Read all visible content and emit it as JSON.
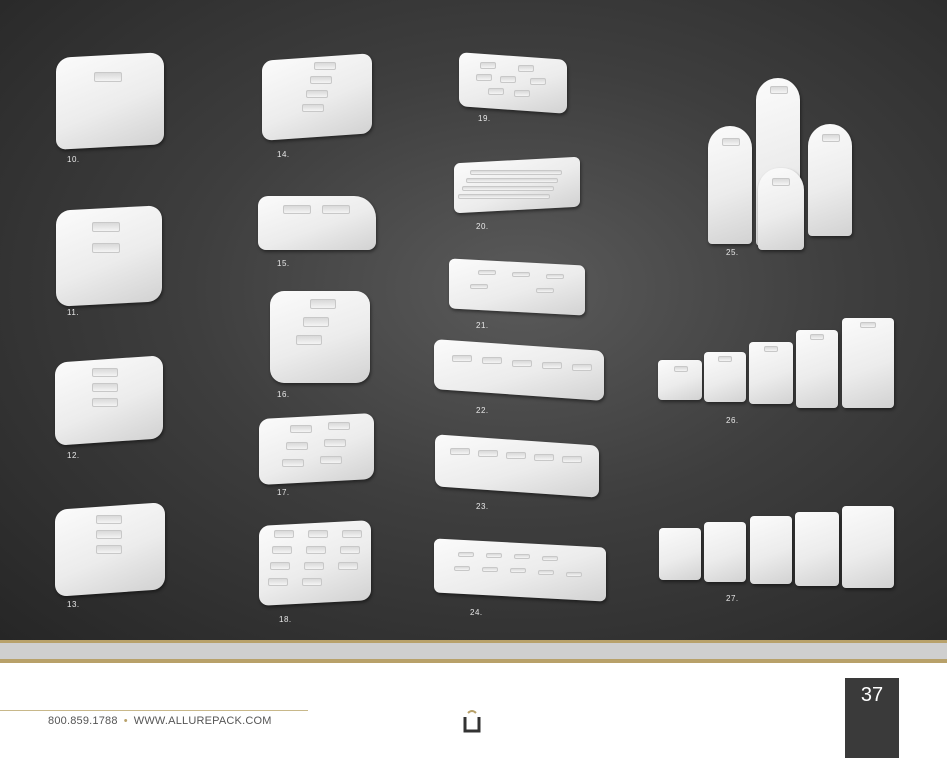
{
  "catalog": {
    "items": [
      {
        "label": "10."
      },
      {
        "label": "11."
      },
      {
        "label": "12."
      },
      {
        "label": "13."
      },
      {
        "label": "14."
      },
      {
        "label": "15."
      },
      {
        "label": "16."
      },
      {
        "label": "17."
      },
      {
        "label": "18."
      },
      {
        "label": "19."
      },
      {
        "label": "20."
      },
      {
        "label": "21."
      },
      {
        "label": "22."
      },
      {
        "label": "23."
      },
      {
        "label": "24."
      },
      {
        "label": "25."
      },
      {
        "label": "26."
      },
      {
        "label": "27."
      }
    ]
  },
  "footer": {
    "phone": "800.859.1788",
    "website": "WWW.ALLUREPACK.COM",
    "separator": "•",
    "page_number": "37"
  },
  "colors": {
    "accent_gold": "#b8a16a",
    "background_dark": "#3a3a3a"
  },
  "icons": {
    "logo": "allurepack-u-logo"
  }
}
